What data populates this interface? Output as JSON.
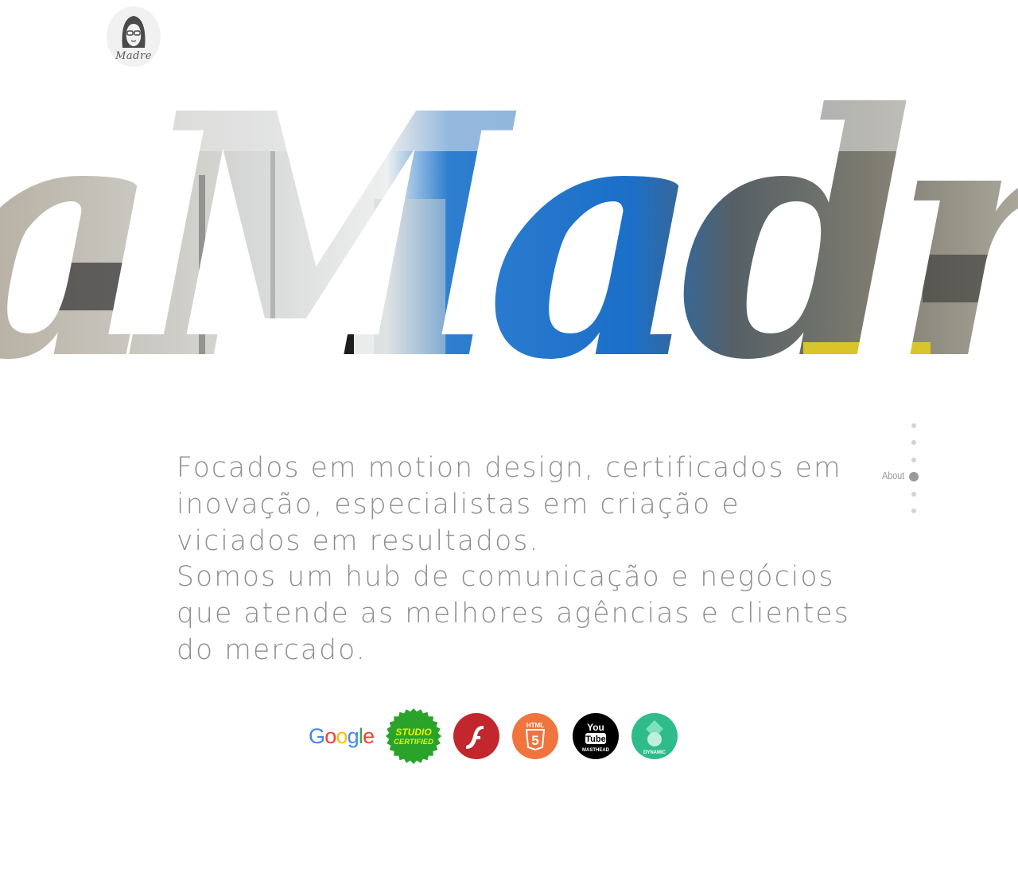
{
  "logo": {
    "text": "Madre",
    "icon": "nun-avatar-icon"
  },
  "hero": {
    "word": "aMadre",
    "icon": "office-photo-in-script-lettering"
  },
  "about": {
    "paragraph_1": "Focados em motion design, certificados em inovação, especialistas em criação e viciados em resultados.",
    "paragraph_2": "Somos um hub de comunicação e negócios que atende as melhores agências e clientes do mercado."
  },
  "section_nav": {
    "active_label": "About",
    "dots": 6,
    "active_index": 3
  },
  "badges": {
    "google": {
      "label": "Google",
      "colors": [
        "#4285F4",
        "#EA4335",
        "#FBBC05",
        "#4285F4",
        "#34A853",
        "#EA4335"
      ]
    },
    "studio_certified": {
      "line1": "STUDIO",
      "line2": "CERTIFIED",
      "color": "#2aa32a",
      "text_color": "#e8f400"
    },
    "flash": {
      "icon": "flash-player-icon",
      "color": "#c1272d"
    },
    "html5": {
      "label": "HTML",
      "number": "5",
      "color": "#f0743e"
    },
    "youtube": {
      "line1": "You",
      "line2": "Tube",
      "line3": "MASTHEAD",
      "color": "#000000"
    },
    "dynamic": {
      "label": "DYNAMIC",
      "color": "#2ebd8a"
    }
  }
}
